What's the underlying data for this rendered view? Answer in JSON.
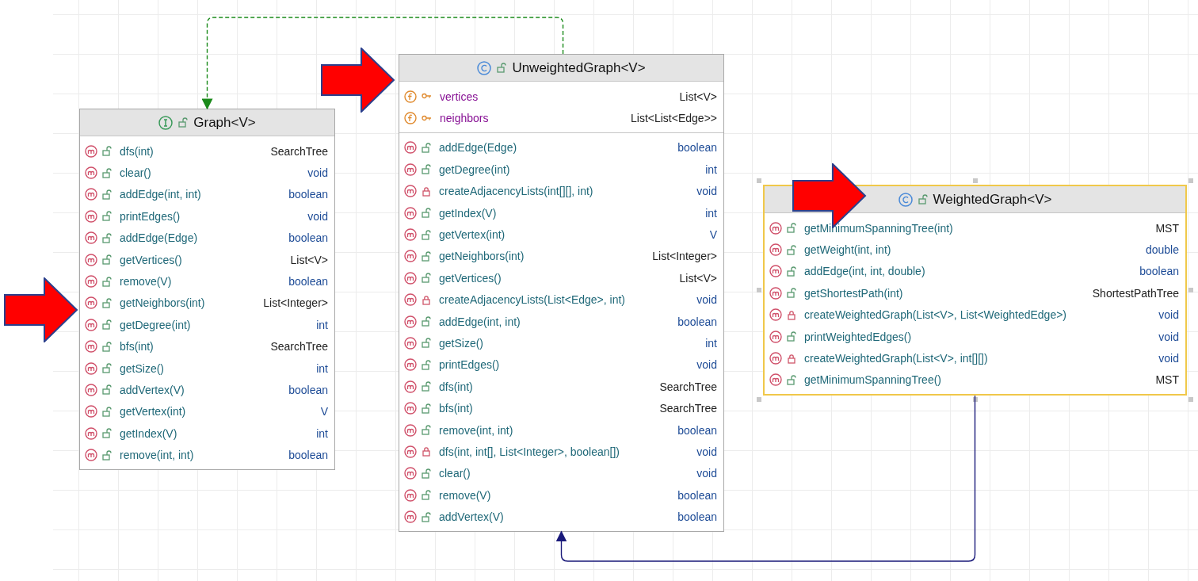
{
  "nodes": [
    {
      "kind": "interface",
      "title": "Graph<V>",
      "selected": false,
      "methods": [
        {
          "private": false,
          "signature": "dfs(int)",
          "type": "SearchTree",
          "primitive": false
        },
        {
          "private": false,
          "signature": "clear()",
          "type": "void",
          "primitive": true
        },
        {
          "private": false,
          "signature": "addEdge(int, int)",
          "type": "boolean",
          "primitive": true
        },
        {
          "private": false,
          "signature": "printEdges()",
          "type": "void",
          "primitive": true
        },
        {
          "private": false,
          "signature": "addEdge(Edge)",
          "type": "boolean",
          "primitive": true
        },
        {
          "private": false,
          "signature": "getVertices()",
          "type": "List<V>",
          "primitive": false
        },
        {
          "private": false,
          "signature": "remove(V)",
          "type": "boolean",
          "primitive": true
        },
        {
          "private": false,
          "signature": "getNeighbors(int)",
          "type": "List<Integer>",
          "primitive": false
        },
        {
          "private": false,
          "signature": "getDegree(int)",
          "type": "int",
          "primitive": true
        },
        {
          "private": false,
          "signature": "bfs(int)",
          "type": "SearchTree",
          "primitive": false
        },
        {
          "private": false,
          "signature": "getSize()",
          "type": "int",
          "primitive": true
        },
        {
          "private": false,
          "signature": "addVertex(V)",
          "type": "boolean",
          "primitive": true
        },
        {
          "private": false,
          "signature": "getVertex(int)",
          "type": "V",
          "primitive": true
        },
        {
          "private": false,
          "signature": "getIndex(V)",
          "type": "int",
          "primitive": true
        },
        {
          "private": false,
          "signature": "remove(int, int)",
          "type": "boolean",
          "primitive": true
        }
      ]
    },
    {
      "kind": "class",
      "title": "UnweightedGraph<V>",
      "selected": false,
      "link": {
        "kind": "implements"
      },
      "fields": [
        {
          "name": "vertices",
          "type": "List<V>"
        },
        {
          "name": "neighbors",
          "type": "List<List<Edge>>"
        }
      ],
      "methods": [
        {
          "private": false,
          "signature": "addEdge(Edge)",
          "type": "boolean",
          "primitive": true
        },
        {
          "private": false,
          "signature": "getDegree(int)",
          "type": "int",
          "primitive": true
        },
        {
          "private": true,
          "signature": "createAdjacencyLists(int[][], int)",
          "type": "void",
          "primitive": true
        },
        {
          "private": false,
          "signature": "getIndex(V)",
          "type": "int",
          "primitive": true
        },
        {
          "private": false,
          "signature": "getVertex(int)",
          "type": "V",
          "primitive": true
        },
        {
          "private": false,
          "signature": "getNeighbors(int)",
          "type": "List<Integer>",
          "primitive": false
        },
        {
          "private": false,
          "signature": "getVertices()",
          "type": "List<V>",
          "primitive": false
        },
        {
          "private": true,
          "signature": "createAdjacencyLists(List<Edge>, int)",
          "type": "void",
          "primitive": true
        },
        {
          "private": false,
          "signature": "addEdge(int, int)",
          "type": "boolean",
          "primitive": true
        },
        {
          "private": false,
          "signature": "getSize()",
          "type": "int",
          "primitive": true
        },
        {
          "private": false,
          "signature": "printEdges()",
          "type": "void",
          "primitive": true
        },
        {
          "private": false,
          "signature": "dfs(int)",
          "type": "SearchTree",
          "primitive": false
        },
        {
          "private": false,
          "signature": "bfs(int)",
          "type": "SearchTree",
          "primitive": false
        },
        {
          "private": false,
          "signature": "remove(int, int)",
          "type": "boolean",
          "primitive": true
        },
        {
          "private": true,
          "signature": "dfs(int, int[], List<Integer>, boolean[])",
          "type": "void",
          "primitive": true
        },
        {
          "private": false,
          "signature": "clear()",
          "type": "void",
          "primitive": true
        },
        {
          "private": false,
          "signature": "remove(V)",
          "type": "boolean",
          "primitive": true
        },
        {
          "private": false,
          "signature": "addVertex(V)",
          "type": "boolean",
          "primitive": true
        }
      ]
    },
    {
      "kind": "class",
      "title": "WeightedGraph<V>",
      "selected": true,
      "link": {
        "kind": "extends"
      },
      "methods": [
        {
          "private": false,
          "signature": "getMinimumSpanningTree(int)",
          "type": "MST",
          "primitive": false
        },
        {
          "private": false,
          "signature": "getWeight(int, int)",
          "type": "double",
          "primitive": true
        },
        {
          "private": false,
          "signature": "addEdge(int, int, double)",
          "type": "boolean",
          "primitive": true
        },
        {
          "private": false,
          "signature": "getShortestPath(int)",
          "type": "ShortestPathTree",
          "primitive": false
        },
        {
          "private": true,
          "signature": "createWeightedGraph(List<V>, List<WeightedEdge>)",
          "type": "void",
          "primitive": true
        },
        {
          "private": false,
          "signature": "printWeightedEdges()",
          "type": "void",
          "primitive": true
        },
        {
          "private": true,
          "signature": "createWeightedGraph(List<V>, int[][])",
          "type": "void",
          "primitive": true
        },
        {
          "private": false,
          "signature": "getMinimumSpanningTree()",
          "type": "MST",
          "primitive": false
        }
      ]
    }
  ]
}
